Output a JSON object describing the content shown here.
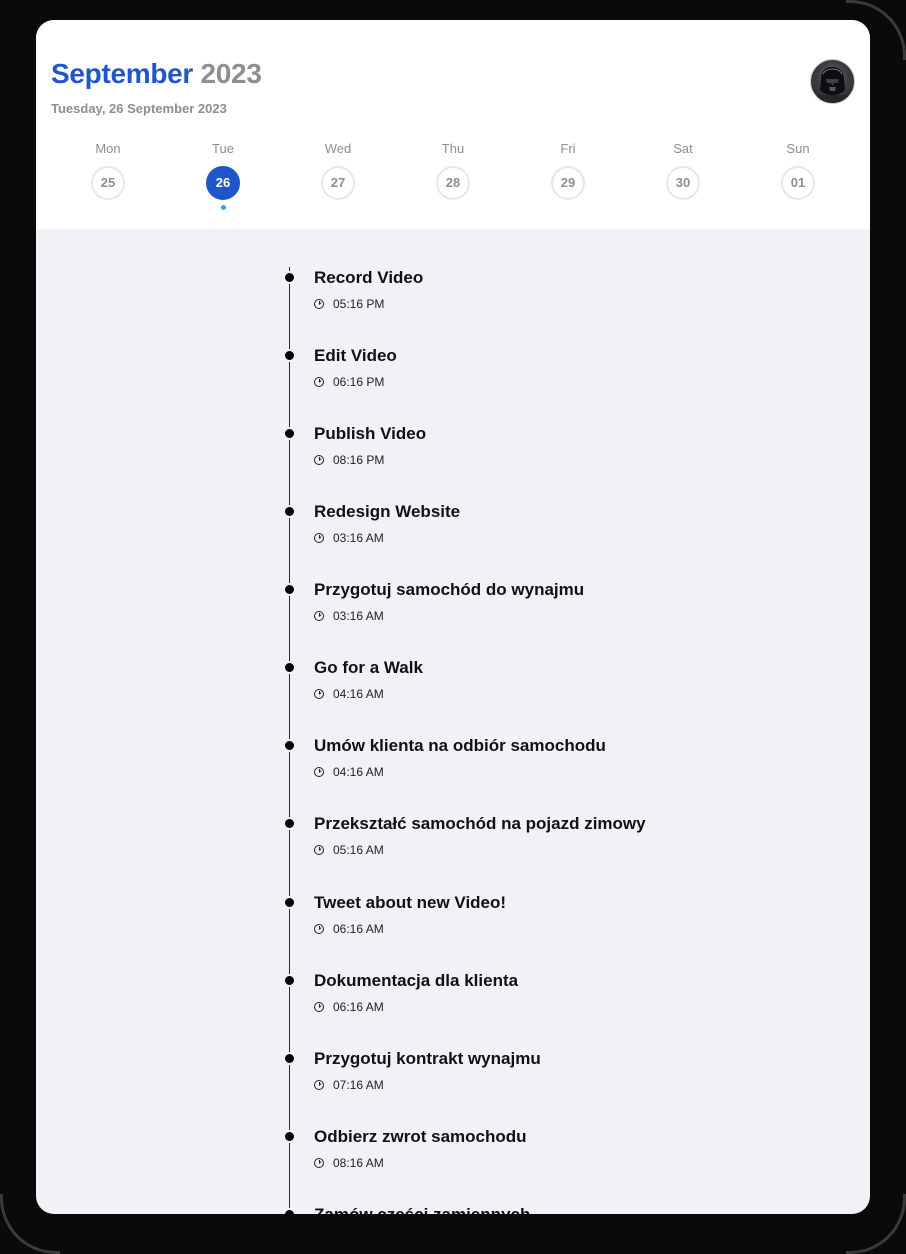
{
  "header": {
    "month": "September",
    "year": "2023",
    "subtitle": "Tuesday, 26 September 2023"
  },
  "week": {
    "days": [
      {
        "name": "Mon",
        "num": "25",
        "selected": false
      },
      {
        "name": "Tue",
        "num": "26",
        "selected": true
      },
      {
        "name": "Wed",
        "num": "27",
        "selected": false
      },
      {
        "name": "Thu",
        "num": "28",
        "selected": false
      },
      {
        "name": "Fri",
        "num": "29",
        "selected": false
      },
      {
        "name": "Sat",
        "num": "30",
        "selected": false
      },
      {
        "name": "Sun",
        "num": "01",
        "selected": false
      }
    ]
  },
  "events": [
    {
      "title": "Record Video",
      "time": "05:16 PM"
    },
    {
      "title": "Edit Video",
      "time": "06:16 PM"
    },
    {
      "title": "Publish Video",
      "time": "08:16 PM"
    },
    {
      "title": "Redesign Website",
      "time": "03:16 AM"
    },
    {
      "title": "Przygotuj samochód do wynajmu",
      "time": "03:16 AM"
    },
    {
      "title": "Go for a Walk",
      "time": "04:16 AM"
    },
    {
      "title": "Umów klienta na odbiór samochodu",
      "time": "04:16 AM"
    },
    {
      "title": "Przekształć samochód na pojazd zimowy",
      "time": "05:16 AM"
    },
    {
      "title": "Tweet about new Video!",
      "time": "06:16 AM"
    },
    {
      "title": "Dokumentacja dla klienta",
      "time": "06:16 AM"
    },
    {
      "title": "Przygotuj kontrakt wynajmu",
      "time": "07:16 AM"
    },
    {
      "title": "Odbierz zwrot samochodu",
      "time": "08:16 AM"
    },
    {
      "title": "Zamów części zamiennych",
      "time": ""
    }
  ],
  "colors": {
    "accent": "#1f56c9",
    "muted": "#8e8e93",
    "indicator": "#2ea7f5"
  },
  "icons": {
    "avatar": "profile-avatar",
    "time": "clock-icon"
  }
}
